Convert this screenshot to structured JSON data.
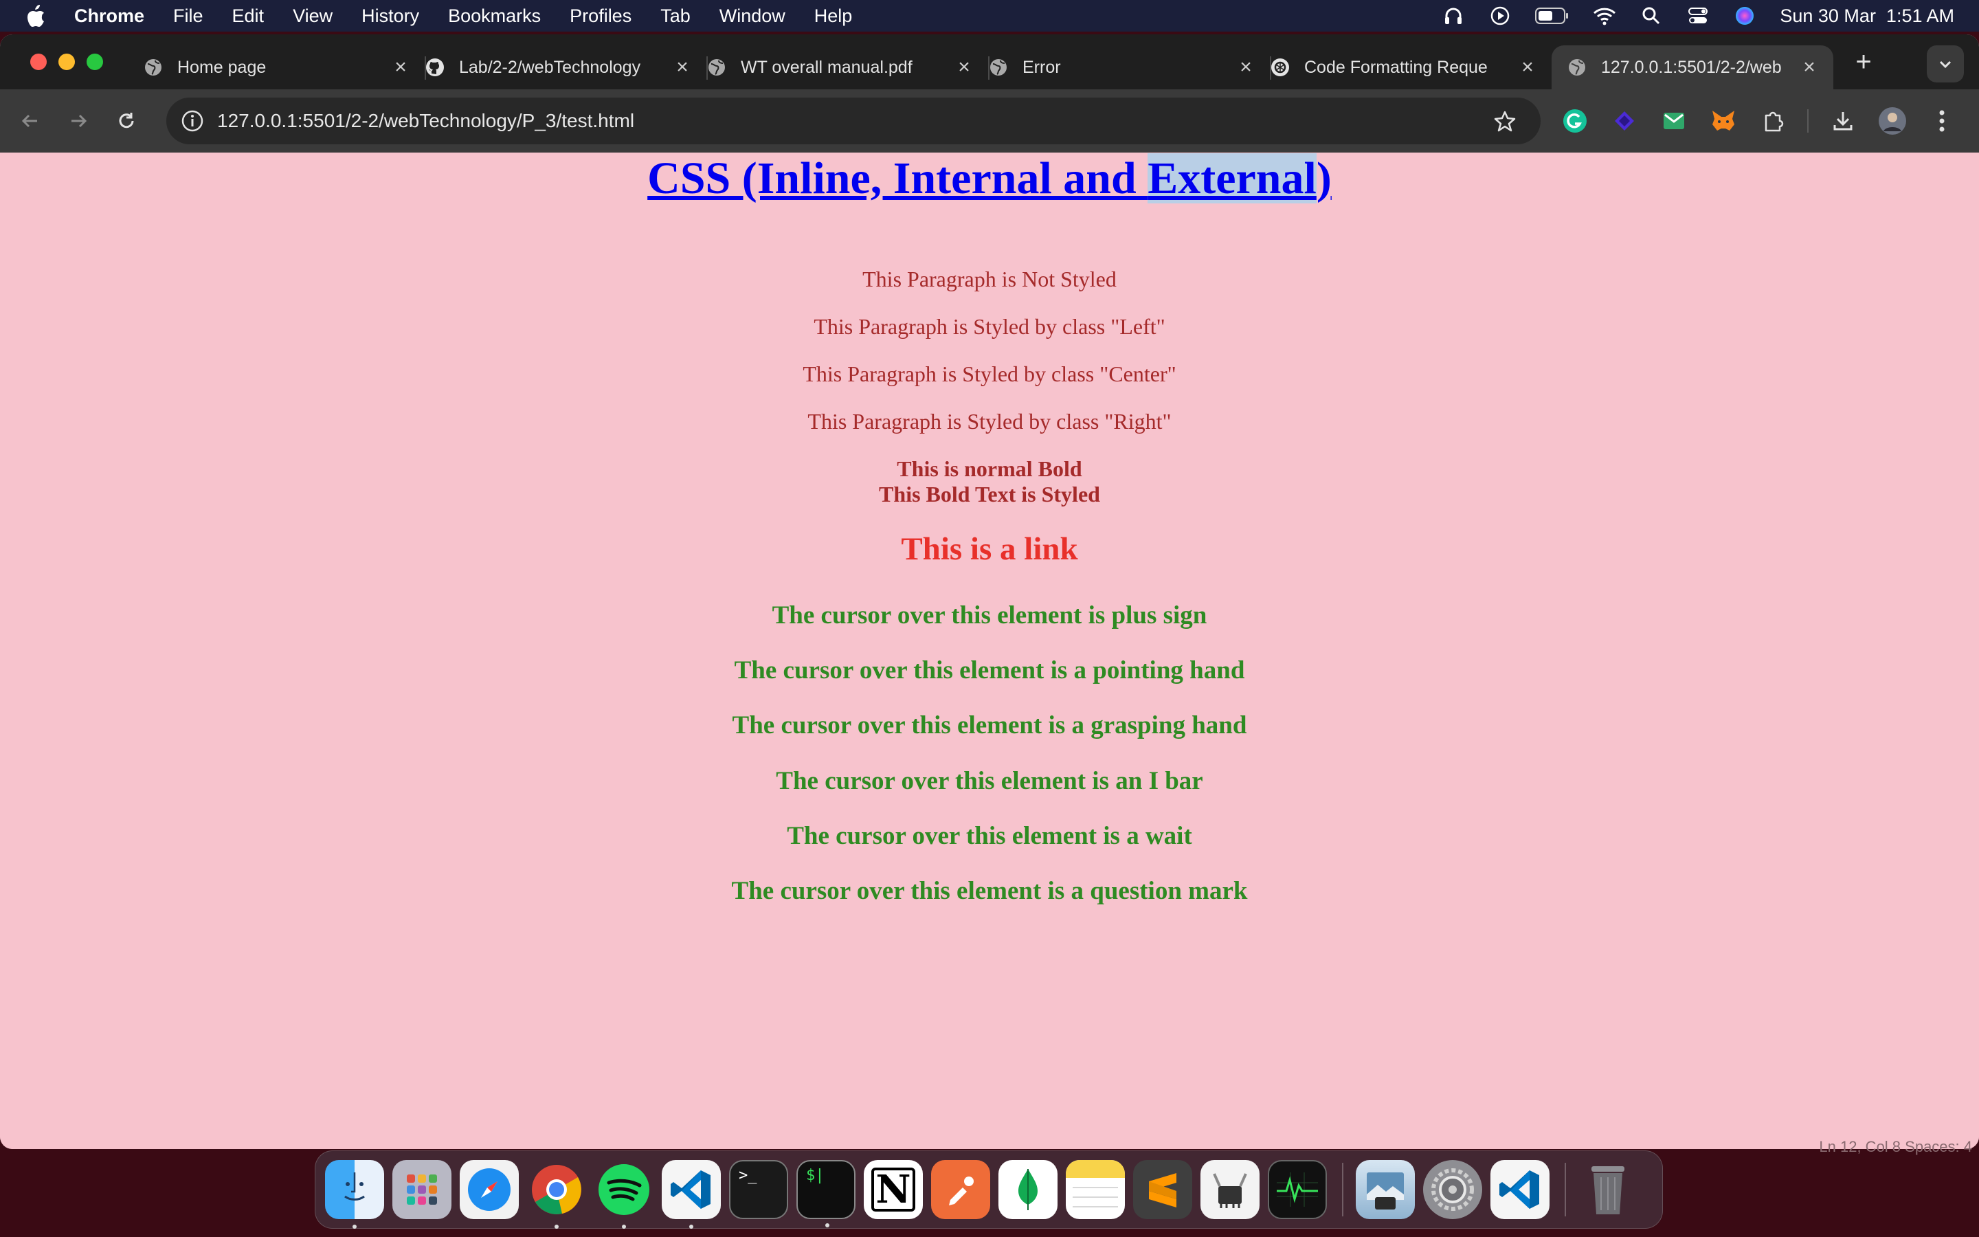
{
  "menubar": {
    "app_name": "Chrome",
    "items": [
      "File",
      "Edit",
      "View",
      "History",
      "Bookmarks",
      "Profiles",
      "Tab",
      "Window",
      "Help"
    ],
    "datetime": "Sun 30 Mar  1:51 AM",
    "status_icons": [
      "headphones-icon",
      "play-circle-icon",
      "battery-icon",
      "wifi-icon",
      "spotlight-search-icon",
      "control-center-icon",
      "siri-icon"
    ]
  },
  "tabs": [
    {
      "title": "Home page",
      "favicon": "globe-icon",
      "active": false
    },
    {
      "title": "Lab/2-2/webTechnology",
      "favicon": "github-icon",
      "active": false
    },
    {
      "title": "WT overall manual.pdf",
      "favicon": "globe-icon",
      "active": false
    },
    {
      "title": "Error",
      "favicon": "globe-icon",
      "active": false
    },
    {
      "title": "Code Formatting Reque",
      "favicon": "openai-icon",
      "active": false
    },
    {
      "title": "127.0.0.1:5501/2-2/web",
      "favicon": "globe-icon",
      "active": true
    }
  ],
  "toolbar": {
    "url": "127.0.0.1:5501/2-2/webTechnology/P_3/test.html",
    "extensions": [
      "grammarly-icon",
      "extension-diamond-icon",
      "extension-mail-icon",
      "metamask-icon",
      "extensions-puzzle-icon",
      "download-icon",
      "profile-avatar"
    ]
  },
  "page": {
    "heading_part1": "CSS (Inline, Internal and ",
    "heading_part2": "External",
    "heading_part3": ")",
    "p_not_styled": "This Paragraph is Not Styled",
    "p_left": "This Paragraph is Styled by class \"Left\"",
    "p_center": "This Paragraph is Styled by class \"Center\"",
    "p_right": "This Paragraph is Styled by class \"Right\"",
    "bold_normal": "This is normal Bold",
    "bold_styled": "This Bold Text is Styled",
    "link": "This is a link",
    "cursor_lines": [
      "The cursor over this element is plus sign",
      "The cursor over this element is a pointing hand",
      "The cursor over this element is a grasping hand",
      "The cursor over this element is an I bar",
      "The cursor over this element is a wait",
      "The cursor over this element is a question mark"
    ]
  },
  "behind_window_text": "Ln 12, Col 8    Spaces: 4",
  "dock": {
    "apps": [
      "finder-icon",
      "launchpad-icon",
      "safari-icon",
      "chrome-icon",
      "spotify-icon",
      "vscode-icon",
      "terminal-icon",
      "iterm-icon",
      "notion-icon",
      "postman-icon",
      "mongodb-compass-icon",
      "notes-icon",
      "sublime-text-icon",
      "system-information-icon",
      "activity-monitor-icon",
      "preview-icon",
      "system-settings-icon",
      "vscode-icon",
      "trash-icon"
    ],
    "notion_letter": "N",
    "terminal_prompt": ">_",
    "iterm_prompt": "$|"
  },
  "colors": {
    "page_background": "#f7c3cd",
    "heading": "#0000ee",
    "paragraph": "#a52a2a",
    "link": "#e8302a",
    "cursor_text": "#2e8b22"
  }
}
